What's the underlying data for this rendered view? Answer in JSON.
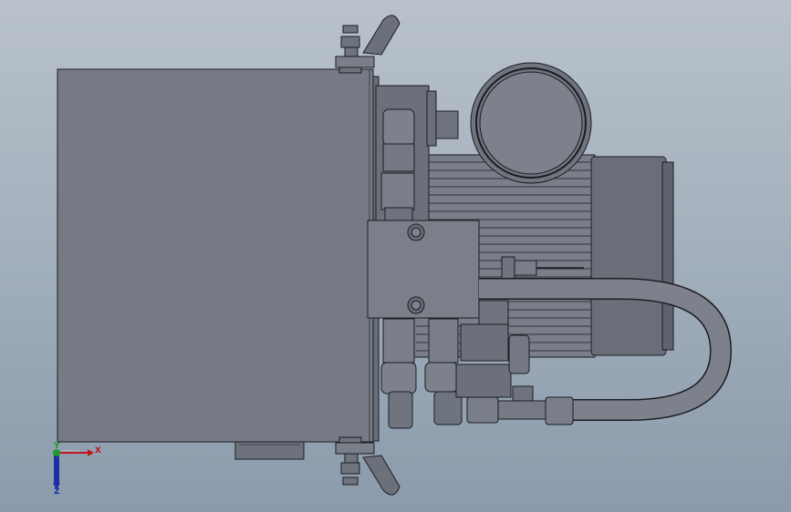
{
  "scene": {
    "title": "",
    "background_top": "#b9c2cc",
    "background_bottom": "#8b9bab",
    "part_fill": "#767a85",
    "part_fill_light": "#868a95",
    "part_fill_dark": "#5f636d",
    "edge_color": "#1b1d22"
  },
  "components": {
    "tank": "reservoir-tank",
    "manifold": "valve-manifold",
    "motor": "electric-motor",
    "gauge": "pressure-gauge",
    "hose": "flexible-hose"
  },
  "triad": {
    "x_label": "X",
    "y_label": "Y",
    "z_label": "Z",
    "x_color": "#c0161c",
    "y_color": "#1a9a2a",
    "z_color": "#1c2fa8"
  }
}
